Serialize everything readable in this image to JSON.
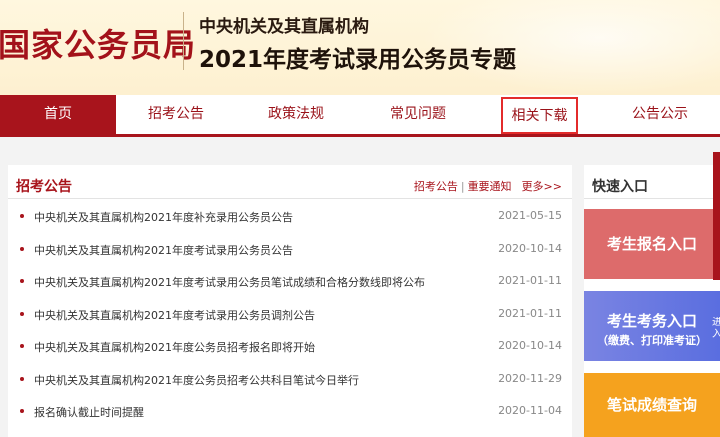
{
  "header": {
    "site_name": "国家公务员局",
    "subtitle1": "中央机关及其直属机构",
    "subtitle2": "2021年度考试录用公务员专题"
  },
  "nav": {
    "items": [
      {
        "label": "首页"
      },
      {
        "label": "招考公告"
      },
      {
        "label": "政策法规"
      },
      {
        "label": "常见问题"
      },
      {
        "label": "相关下载"
      },
      {
        "label": "公告公示"
      }
    ]
  },
  "main": {
    "title": "招考公告",
    "link1": "招考公告",
    "separator": "|",
    "link2": "重要通知",
    "more": "更多>>",
    "items": [
      {
        "text": "中央机关及其直属机构2021年度补充录用公务员公告",
        "date": "2021-05-15"
      },
      {
        "text": "中央机关及其直属机构2021年度考试录用公务员公告",
        "date": "2020-10-14"
      },
      {
        "text": "中央机关及其直属机构2021年度考试录用公务员笔试成绩和合格分数线即将公布",
        "date": "2021-01-11"
      },
      {
        "text": "中央机关及其直属机构2021年度考试录用公务员调剂公告",
        "date": "2021-01-11"
      },
      {
        "text": "中央机关及其直属机构2021年度公务员招考报名即将开始",
        "date": "2020-10-14"
      },
      {
        "text": "中央机关及其直属机构2021年度公务员招考公共科目笔试今日举行",
        "date": "2020-11-29"
      },
      {
        "text": "报名确认截止时间提醒",
        "date": "2020-11-04"
      }
    ]
  },
  "side": {
    "title": "快速入口",
    "btn_register": "考生报名入口",
    "btn_affairs": "考生考务入口",
    "btn_affairs_sub": "（缴费、打印准考证）",
    "btn_scores": "笔试成绩查询"
  },
  "edge_text": "进入",
  "colors": {
    "brand_red": "#a8141c",
    "highlight_border": "#e32b2b",
    "btn_register": "#dd6b6b",
    "btn_affairs": "#6a78e1",
    "btn_scores": "#f5a21e"
  }
}
